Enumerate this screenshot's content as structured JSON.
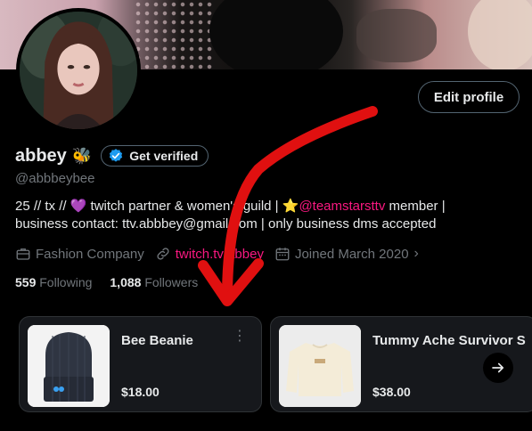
{
  "profile": {
    "display_name": "abbey",
    "name_emoji": "🐝",
    "handle": "@abbbeybee",
    "get_verified_label": "Get verified",
    "edit_profile_label": "Edit profile",
    "bio": {
      "line1_a": "25 // tx // ",
      "line1_heart": "💜",
      "line1_b": " twitch partner & women's guild | ",
      "line1_star": "⭐",
      "line1_mention": "@teamstarsttv",
      "line1_c": " member |",
      "line2": "business contact: ttv.abbbey@gmail.com | only business dms accepted"
    },
    "meta": {
      "category": "Fashion Company",
      "link": "twitch.tv/abbey",
      "joined": "Joined March 2020",
      "category_icon": "briefcase-icon",
      "link_icon": "link-icon",
      "joined_icon": "calendar-icon"
    },
    "stats": {
      "following_count": "559",
      "following_label": "Following",
      "followers_count": "1,088",
      "followers_label": "Followers"
    }
  },
  "shop": {
    "items": [
      {
        "title": "Bee Beanie",
        "price": "$18.00"
      },
      {
        "title": "Tummy Ache Survivor S",
        "price": "$38.00"
      }
    ]
  },
  "colors": {
    "accent_link": "#f91880",
    "verified_blue": "#1d9bf0",
    "annotation_red": "#e01010",
    "muted_text": "#71767b"
  }
}
